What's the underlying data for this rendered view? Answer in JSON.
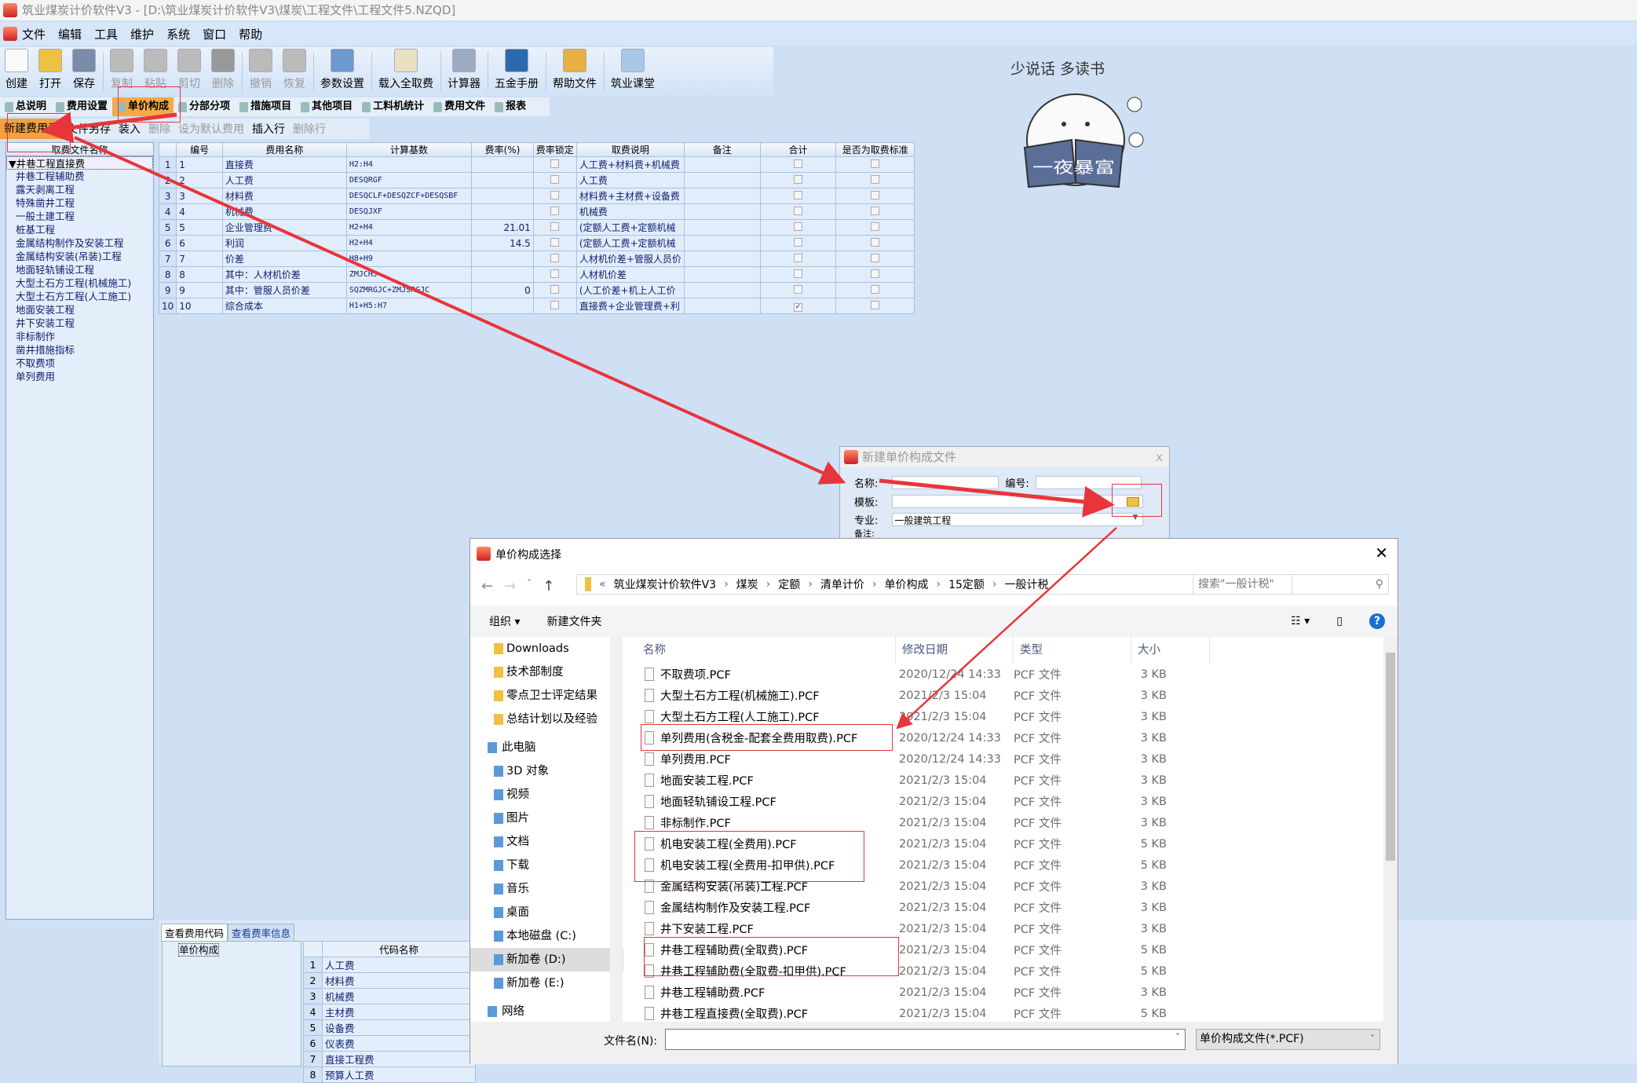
{
  "window": {
    "title": "筑业煤炭计价软件V3 - [D:\\筑业煤炭计价软件V3\\煤炭\\工程文件\\工程文件5.NZQD]"
  },
  "menu": [
    "文件",
    "编辑",
    "工具",
    "维护",
    "系统",
    "窗口",
    "帮助"
  ],
  "toolbar": [
    {
      "label": "创建",
      "icon": "new-file-icon",
      "enabled": true
    },
    {
      "label": "打开",
      "icon": "folder-open-icon",
      "enabled": true
    },
    {
      "label": "保存",
      "icon": "save-icon",
      "enabled": true
    },
    {
      "label": "复制",
      "icon": "copy-icon",
      "enabled": false
    },
    {
      "label": "粘贴",
      "icon": "paste-icon",
      "enabled": false
    },
    {
      "label": "剪切",
      "icon": "cut-icon",
      "enabled": false
    },
    {
      "label": "删除",
      "icon": "delete-icon",
      "enabled": false
    },
    {
      "label": "撤销",
      "icon": "undo-icon",
      "enabled": false
    },
    {
      "label": "恢复",
      "icon": "redo-icon",
      "enabled": false
    },
    {
      "label": "参数设置",
      "icon": "tools-icon",
      "enabled": true
    },
    {
      "label": "载入全取费",
      "icon": "checklist-icon",
      "enabled": true
    },
    {
      "label": "计算器",
      "icon": "calculator-icon",
      "enabled": true
    },
    {
      "label": "五金手册",
      "icon": "omega-icon",
      "enabled": true
    },
    {
      "label": "帮助文件",
      "icon": "book-icon",
      "enabled": true
    },
    {
      "label": "筑业课堂",
      "icon": "classroom-icon",
      "enabled": true
    }
  ],
  "tabs": [
    {
      "label": "总说明"
    },
    {
      "label": "费用设置"
    },
    {
      "label": "单价构成",
      "active": true
    },
    {
      "label": "分部分项"
    },
    {
      "label": "措施项目"
    },
    {
      "label": "其他项目"
    },
    {
      "label": "工料机统计"
    },
    {
      "label": "费用文件"
    },
    {
      "label": "报表"
    }
  ],
  "subtoolbar": [
    {
      "label": "新建费用表",
      "active": true
    },
    {
      "label": "文件另存"
    },
    {
      "label": "装入"
    },
    {
      "label": "删除",
      "disabled": true
    },
    {
      "label": "设为默认费用",
      "disabled": true
    },
    {
      "label": "插入行"
    },
    {
      "label": "删除行",
      "disabled": true
    }
  ],
  "leftpanel": {
    "header": "取费文件名称",
    "root": "▼井巷工程直接费",
    "items": [
      "井巷工程辅助费",
      "露天剥离工程",
      "特殊凿井工程",
      "一般土建工程",
      "桩基工程",
      "金属结构制作及安装工程",
      "金属结构安装(吊装)工程",
      "地面轻轨铺设工程",
      "大型土石方工程(机械施工)",
      "大型土石方工程(人工施工)",
      "地面安装工程",
      "井下安装工程",
      "非标制作",
      "凿井措施指标",
      "不取费项",
      "单列费用"
    ]
  },
  "grid": {
    "columns": [
      "编号",
      "费用名称",
      "计算基数",
      "费率(%)",
      "费率锁定",
      "取费说明",
      "备注",
      "合计",
      "是否为取费标准"
    ],
    "rows": [
      [
        "1",
        "直接费",
        "H2:H4",
        "",
        false,
        "人工费+材料费+机械费",
        "",
        false,
        false
      ],
      [
        "2",
        "人工费",
        "DESQRGF",
        "",
        false,
        "人工费",
        "",
        false,
        false
      ],
      [
        "3",
        "材料费",
        "DESQCLF+DESQZCF+DESQSBF",
        "",
        false,
        "材料费+主材费+设备费",
        "",
        false,
        false
      ],
      [
        "4",
        "机械费",
        "DESQJXF",
        "",
        false,
        "机械费",
        "",
        false,
        false
      ],
      [
        "5",
        "企业管理费",
        "H2+H4",
        "21.01",
        false,
        "(定额人工费+定额机械",
        "",
        false,
        false
      ],
      [
        "6",
        "利润",
        "H2+H4",
        "14.5",
        false,
        "(定额人工费+定额机械",
        "",
        false,
        false
      ],
      [
        "7",
        "价差",
        "H8+H9",
        "",
        false,
        "人材机价差+管服人员价",
        "",
        false,
        false
      ],
      [
        "8",
        "其中：人材机价差",
        "ZMJCHJ",
        "",
        false,
        "人材机价差",
        "",
        false,
        false
      ],
      [
        "9",
        "其中：管服人员价差",
        "SQZMRGJC+ZMJSRGJC",
        "0",
        false,
        "(人工价差+机上人工价",
        "",
        false,
        false
      ],
      [
        "10",
        "综合成本",
        "H1+H5:H7",
        "",
        false,
        "直接费+企业管理费+利",
        "",
        true,
        false
      ]
    ]
  },
  "bottom": {
    "tabs": [
      "查看费用代码",
      "查看费率信息"
    ],
    "tree_root": "单价构成",
    "code_header": "代码名称",
    "codes": [
      "人工费",
      "材料费",
      "机械费",
      "主材费",
      "设备费",
      "仪表费",
      "直接工程费",
      "预算人工费"
    ]
  },
  "sticker": {
    "text_top": "少说话 多读书",
    "book_text": "一夜暴富"
  },
  "new_dialog": {
    "title": "新建单价构成文件",
    "name_label": "名称:",
    "code_label": "编号:",
    "template_label": "模板:",
    "specialty_label": "专业:",
    "specialty_value": "一般建筑工程",
    "remark_label": "备注:"
  },
  "file_dialog": {
    "title": "单价构成选择",
    "breadcrumb": [
      "筑业煤炭计价软件V3",
      "煤炭",
      "定额",
      "清单计价",
      "单价构成",
      "15定额",
      "一般计税"
    ],
    "search_placeholder": "搜索\"一般计税\"",
    "organize": "组织 ▾",
    "new_folder": "新建文件夹",
    "nav": [
      {
        "label": "Downloads",
        "type": "folder"
      },
      {
        "label": "技术部制度",
        "type": "folder"
      },
      {
        "label": "零点卫士评定结果",
        "type": "folder"
      },
      {
        "label": "总结计划以及经验",
        "type": "folder"
      },
      {
        "label": "此电脑",
        "type": "pc"
      },
      {
        "label": "3D 对象",
        "type": "drive"
      },
      {
        "label": "视频",
        "type": "drive"
      },
      {
        "label": "图片",
        "type": "drive"
      },
      {
        "label": "文档",
        "type": "drive"
      },
      {
        "label": "下载",
        "type": "drive"
      },
      {
        "label": "音乐",
        "type": "drive"
      },
      {
        "label": "桌面",
        "type": "drive"
      },
      {
        "label": "本地磁盘 (C:)",
        "type": "drive"
      },
      {
        "label": "新加卷 (D:)",
        "type": "drive",
        "selected": true
      },
      {
        "label": "新加卷 (E:)",
        "type": "drive"
      },
      {
        "label": "网络",
        "type": "pc"
      }
    ],
    "columns": [
      "名称",
      "修改日期",
      "类型",
      "大小"
    ],
    "files": [
      [
        "不取费项.PCF",
        "2020/12/24 14:33",
        "PCF 文件",
        "3 KB"
      ],
      [
        "大型土石方工程(机械施工).PCF",
        "2021/2/3 15:04",
        "PCF 文件",
        "3 KB"
      ],
      [
        "大型土石方工程(人工施工).PCF",
        "2021/2/3 15:04",
        "PCF 文件",
        "3 KB"
      ],
      [
        "单列费用(含税金-配套全费用取费).PCF",
        "2020/12/24 14:33",
        "PCF 文件",
        "3 KB"
      ],
      [
        "单列费用.PCF",
        "2020/12/24 14:33",
        "PCF 文件",
        "3 KB"
      ],
      [
        "地面安装工程.PCF",
        "2021/2/3 15:04",
        "PCF 文件",
        "3 KB"
      ],
      [
        "地面轻轨铺设工程.PCF",
        "2021/2/3 15:04",
        "PCF 文件",
        "3 KB"
      ],
      [
        "非标制作.PCF",
        "2021/2/3 15:04",
        "PCF 文件",
        "3 KB"
      ],
      [
        "机电安装工程(全费用).PCF",
        "2021/2/3 15:04",
        "PCF 文件",
        "5 KB"
      ],
      [
        "机电安装工程(全费用-扣甲供).PCF",
        "2021/2/3 15:04",
        "PCF 文件",
        "5 KB"
      ],
      [
        "金属结构安装(吊装)工程.PCF",
        "2021/2/3 15:04",
        "PCF 文件",
        "3 KB"
      ],
      [
        "金属结构制作及安装工程.PCF",
        "2021/2/3 15:04",
        "PCF 文件",
        "3 KB"
      ],
      [
        "井下安装工程.PCF",
        "2021/2/3 15:04",
        "PCF 文件",
        "3 KB"
      ],
      [
        "井巷工程辅助费(全取费).PCF",
        "2021/2/3 15:04",
        "PCF 文件",
        "5 KB"
      ],
      [
        "井巷工程辅助费(全取费-扣甲供).PCF",
        "2021/2/3 15:04",
        "PCF 文件",
        "5 KB"
      ],
      [
        "井巷工程辅助费.PCF",
        "2021/2/3 15:04",
        "PCF 文件",
        "3 KB"
      ],
      [
        "井巷工程直接费(全取费).PCF",
        "2021/2/3 15:04",
        "PCF 文件",
        "5 KB"
      ]
    ],
    "filename_label": "文件名(N):",
    "filename_value": "",
    "filetype": "单价构成文件(*.PCF)"
  },
  "annotation_color": "#e8353a"
}
